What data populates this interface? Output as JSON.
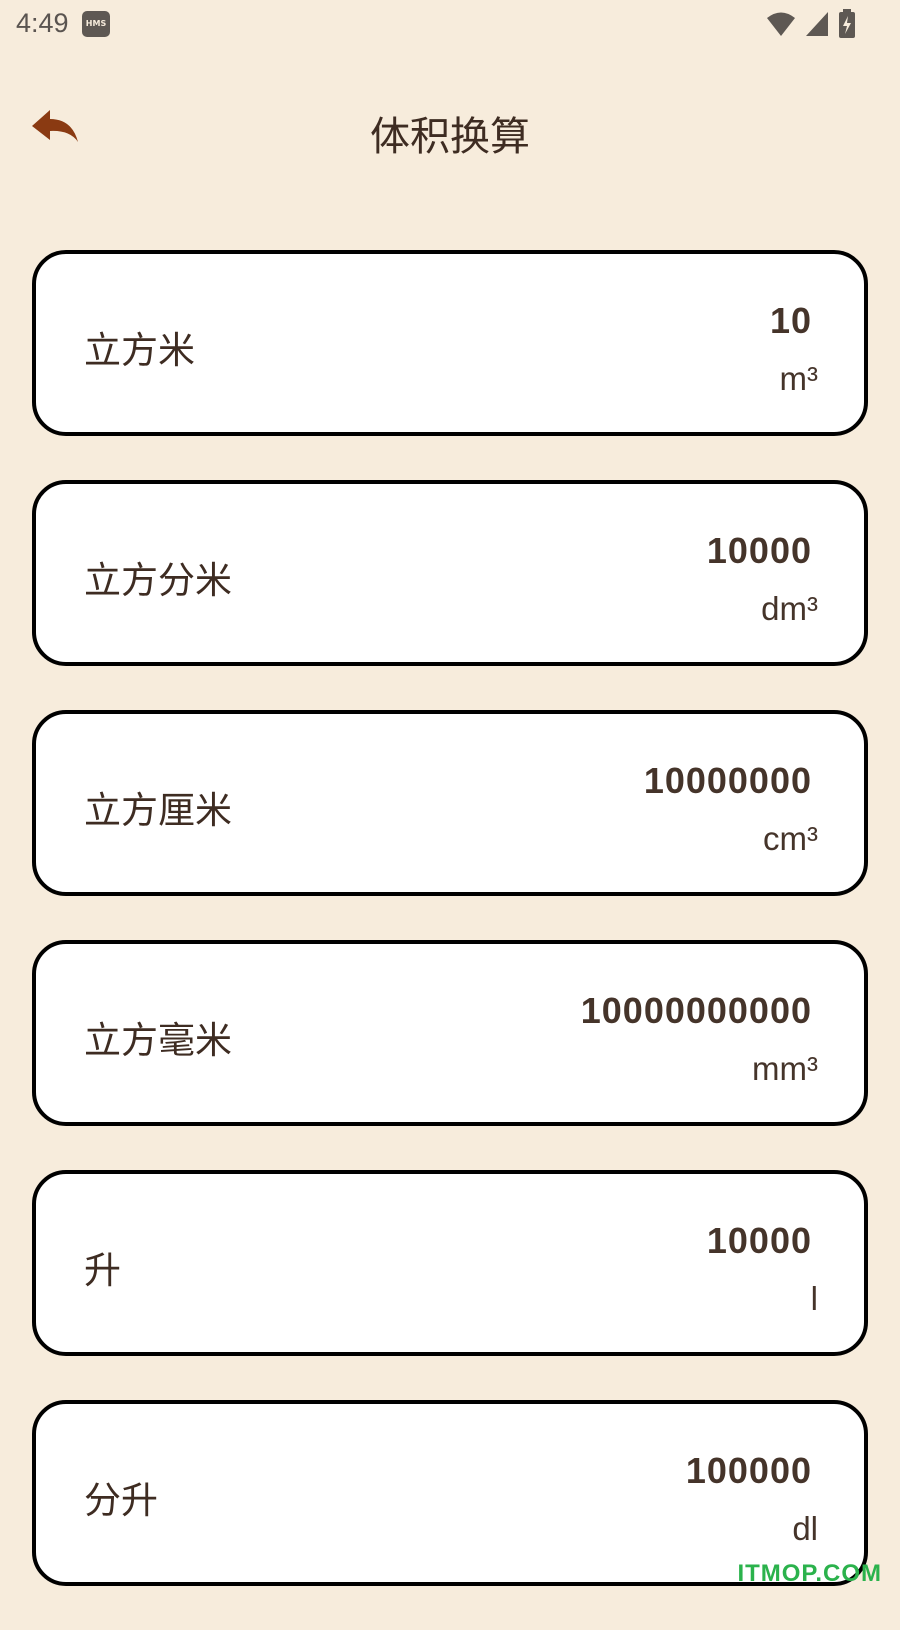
{
  "status_bar": {
    "time": "4:49",
    "badge": "HMS",
    "icons": [
      "wifi-icon",
      "signal-icon",
      "battery-charging-icon"
    ]
  },
  "header": {
    "title": "体积换算",
    "back_icon": "back-arrow-icon",
    "accent_color": "#8a3a12"
  },
  "cards": [
    {
      "name": "立方米",
      "value": "10",
      "unit": "m³"
    },
    {
      "name": "立方分米",
      "value": "10000",
      "unit": "dm³"
    },
    {
      "name": "立方厘米",
      "value": "10000000",
      "unit": "cm³"
    },
    {
      "name": "立方毫米",
      "value": "10000000000",
      "unit": "mm³"
    },
    {
      "name": "升",
      "value": "10000",
      "unit": "l"
    },
    {
      "name": "分升",
      "value": "100000",
      "unit": "dl"
    }
  ],
  "watermark": "ITMOP.COM",
  "colors": {
    "background": "#f7ecdc",
    "card_background": "#ffffff",
    "card_border": "#000000",
    "text": "#3e2c22",
    "watermark": "#2bb24c"
  }
}
